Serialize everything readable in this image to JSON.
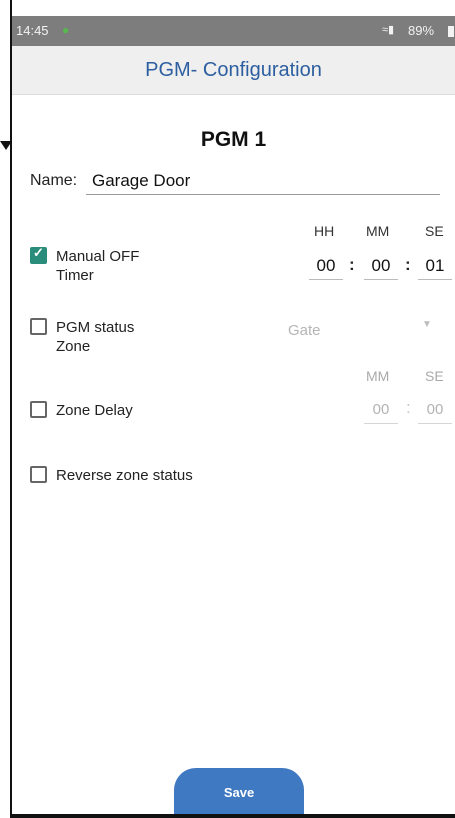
{
  "statusbar": {
    "time": "14:45",
    "battery": "89%"
  },
  "appbar": {
    "title": "PGM- Configuration"
  },
  "heading": "PGM 1",
  "name": {
    "label": "Name:",
    "value": "Garage Door"
  },
  "manual_off_timer": {
    "checked": true,
    "label_line1": "Manual OFF",
    "label_line2": "Timer",
    "headers": {
      "hh": "HH",
      "mm": "MM",
      "se": "SE"
    },
    "values": {
      "hh": "00",
      "mm": "00",
      "se": "01"
    },
    "separator": ":"
  },
  "pgm_status_zone": {
    "checked": false,
    "label_line1": "PGM status",
    "label_line2": "Zone",
    "select_value": "Gate"
  },
  "zone_delay": {
    "checked": false,
    "label": "Zone Delay",
    "headers": {
      "mm": "MM",
      "se": "SE"
    },
    "values": {
      "mm": "00",
      "se": "00"
    },
    "separator": ":"
  },
  "reverse_zone_status": {
    "checked": false,
    "label": "Reverse zone status"
  },
  "save_button": {
    "label": "Save"
  },
  "colors": {
    "accent": "#3f79c2",
    "title": "#2d5fa0",
    "checkbox_checked": "#2a8c7a",
    "statusbar": "#7d7d7d"
  }
}
